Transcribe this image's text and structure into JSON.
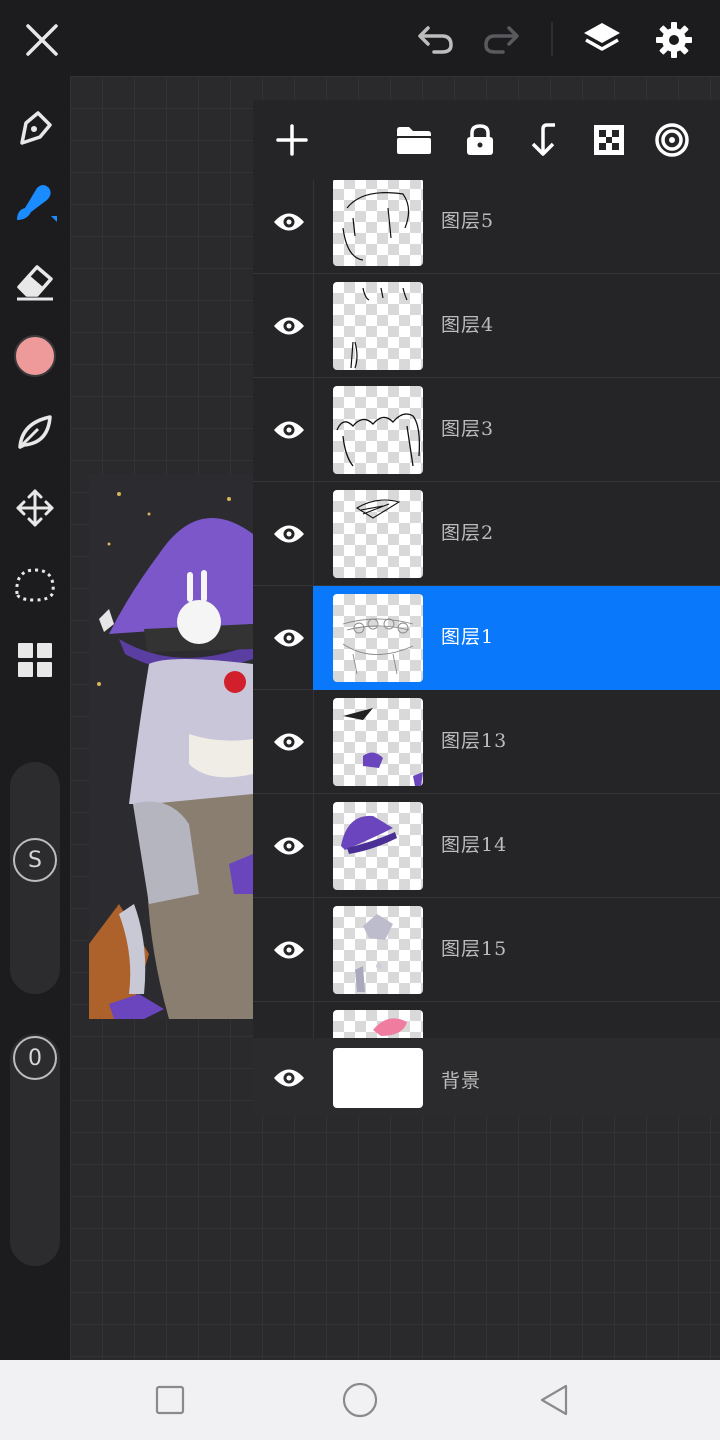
{
  "topbar": {
    "icons": [
      "close-icon",
      "undo-icon",
      "redo-icon",
      "layers-icon",
      "settings-icon"
    ]
  },
  "toolbar": {
    "tools": [
      "pen-icon",
      "brush-icon",
      "eraser-icon",
      "color-swatch",
      "smudge-icon",
      "transform-icon",
      "lasso-icon",
      "gallery-icon"
    ],
    "active_tool": "brush-icon",
    "current_color": "#ef9a9a",
    "accent": "#1a8cff",
    "size_slider_label": "S",
    "opacity_slider_label": "0"
  },
  "layers_panel": {
    "toolbar_icons": [
      "add-layer-icon",
      "folder-icon",
      "lock-icon",
      "merge-down-icon",
      "alpha-lock-icon",
      "blend-mode-icon"
    ],
    "layers": [
      {
        "name": "图层5",
        "visible": true,
        "selected": false
      },
      {
        "name": "图层4",
        "visible": true,
        "selected": false
      },
      {
        "name": "图层3",
        "visible": true,
        "selected": false
      },
      {
        "name": "图层2",
        "visible": true,
        "selected": false
      },
      {
        "name": "图层1",
        "visible": true,
        "selected": true
      },
      {
        "name": "图层13",
        "visible": true,
        "selected": false
      },
      {
        "name": "图层14",
        "visible": true,
        "selected": false
      },
      {
        "name": "图层15",
        "visible": true,
        "selected": false
      },
      {
        "name": "",
        "visible": true,
        "selected": false
      }
    ],
    "background_layer": {
      "name": "背景",
      "visible": true
    },
    "selection_color": "#0a78fa"
  },
  "navbar": {
    "icons": [
      "recent-apps-icon",
      "home-icon",
      "back-icon"
    ]
  }
}
